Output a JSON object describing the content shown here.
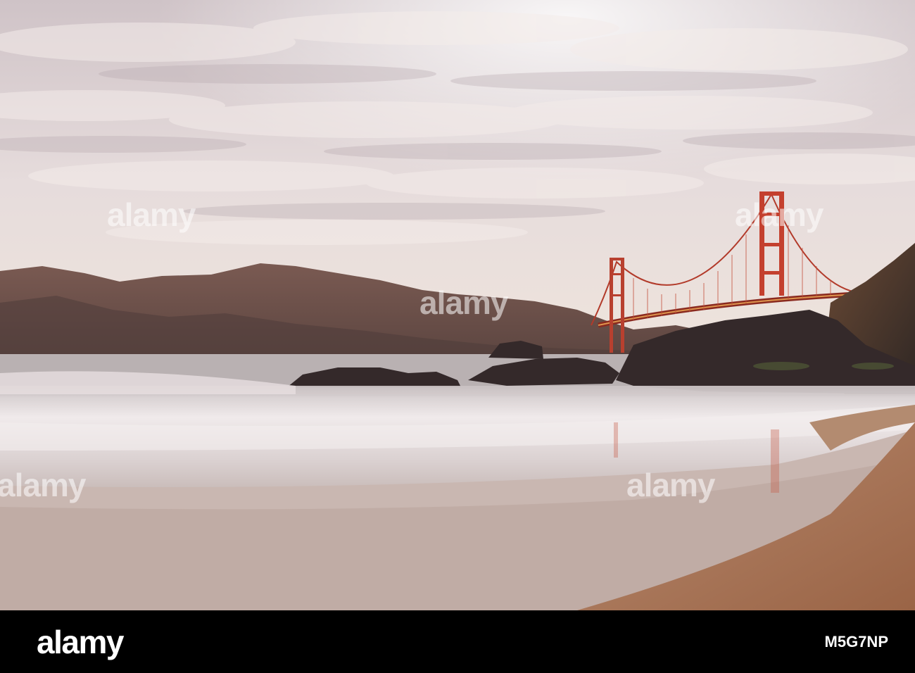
{
  "photo": {
    "subject": "golden-gate-bridge-from-beach",
    "colors": {
      "sky": "#d8ccd0",
      "clouds": "#efe7e6",
      "hills": "#6b4f49",
      "bridge": "#c4402e",
      "water": "#cfc6c6",
      "sand": "#b07a5a",
      "rocks": "#3a302e"
    }
  },
  "watermark": {
    "text": "alamy"
  },
  "footer": {
    "logo": "alamy",
    "image_id": "M5G7NP",
    "background": "#000000"
  }
}
